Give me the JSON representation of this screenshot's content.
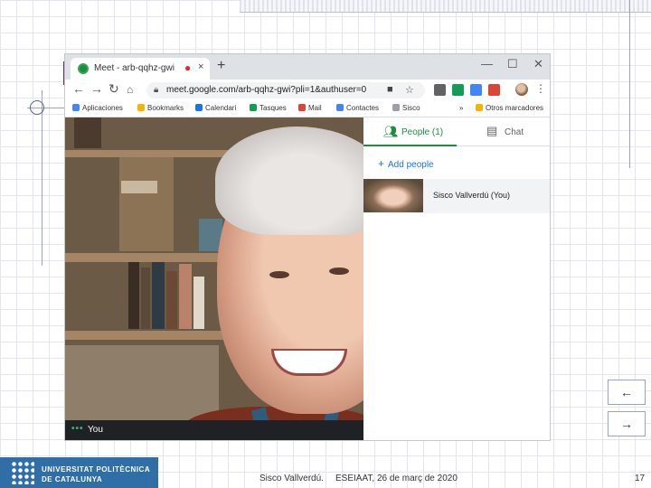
{
  "browser": {
    "tab_title": "Meet - arb-qqhz-gwi",
    "tab_close": "×",
    "new_tab": "+",
    "window_controls": {
      "minimize": "—",
      "maximize": "☐",
      "close": "✕"
    },
    "url": "meet.google.com/arb-qqhz-gwi?pli=1&authuser=0",
    "bookmarks": [
      {
        "label": "Aplicaciones",
        "color": "#4285f4"
      },
      {
        "label": "Bookmarks",
        "color": "#f4b400"
      },
      {
        "label": "Calendari",
        "color": "#1a73e8"
      },
      {
        "label": "Tasques",
        "color": "#0f9d58"
      },
      {
        "label": "Mail",
        "color": "#db4437"
      },
      {
        "label": "Contactes",
        "color": "#4285f4"
      },
      {
        "label": "Sisco",
        "color": "#9aa0a6"
      },
      {
        "label": "Otros marcadores",
        "color": "#f4b400"
      }
    ],
    "bookmark_overflow": "»"
  },
  "meet": {
    "self_label": "You",
    "more_dots": "•••",
    "tabs": {
      "people": "People (1)",
      "chat": "Chat"
    },
    "add_people": "Add people",
    "participants": [
      {
        "name": "Sisco Vallverdú (You)"
      }
    ]
  },
  "slide": {
    "prev_arrow": "←",
    "next_arrow": "→",
    "university_line1": "UNIVERSITAT POLITÈCNICA",
    "university_line2": "DE CATALUNYA",
    "author": "Sisco Vallverdú.",
    "event": "ESEIAAT, 26 de març de 2020",
    "page_number": "17"
  },
  "colors": {
    "meet_green": "#1e8e3e",
    "upc_blue": "#2f6ea6",
    "link_blue": "#1a73e8"
  }
}
